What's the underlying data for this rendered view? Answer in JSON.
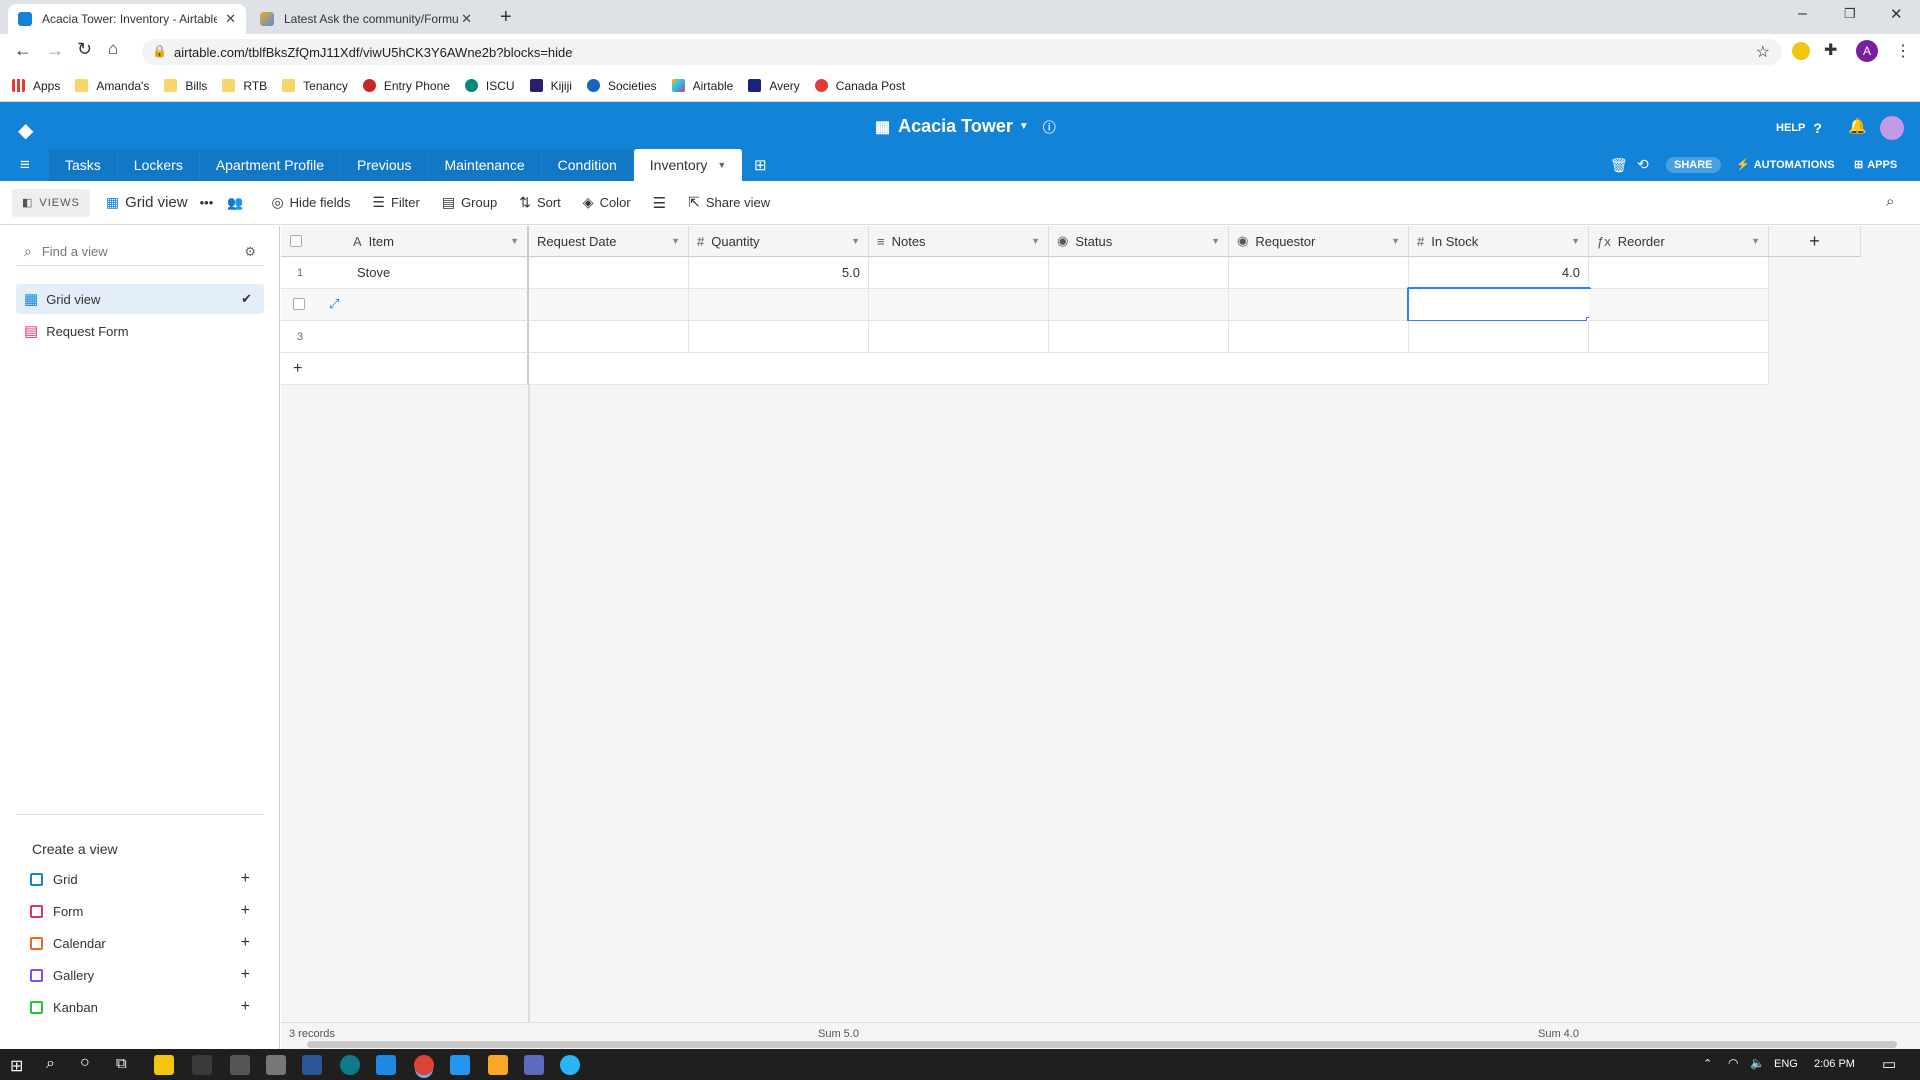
{
  "browser": {
    "tabs": [
      {
        "title": "Acacia Tower: Inventory - Airtable",
        "active": true
      },
      {
        "title": "Latest Ask the community/Formu",
        "active": false
      }
    ],
    "url": "airtable.com/tblfBksZfQmJ11Xdf/viwU5hCK3Y6AWne2b?blocks=hide",
    "profile_initial": "A",
    "bookmarks": [
      "Apps",
      "Amanda's",
      "Bills",
      "RTB",
      "Tenancy",
      "Entry Phone",
      "ISCU",
      "Kijiji",
      "Societies",
      "Airtable",
      "Avery",
      "Canada Post"
    ]
  },
  "base": {
    "title": "Acacia Tower",
    "help": "HELP",
    "share": "SHARE",
    "automations": "AUTOMATIONS",
    "apps": "APPS",
    "tables": [
      "Tasks",
      "Lockers",
      "Apartment Profile",
      "Previous",
      "Maintenance",
      "Condition",
      "Inventory"
    ],
    "active_table": "Inventory"
  },
  "viewbar": {
    "views": "VIEWS",
    "current_view": "Grid view",
    "hide_fields": "Hide fields",
    "filter": "Filter",
    "group": "Group",
    "sort": "Sort",
    "color": "Color",
    "share_view": "Share view"
  },
  "sidebar": {
    "find_placeholder": "Find a view",
    "views": [
      "Grid view",
      "Request Form"
    ],
    "create_label": "Create a view",
    "create_types": [
      "Grid",
      "Form",
      "Calendar",
      "Gallery",
      "Kanban"
    ]
  },
  "grid": {
    "columns": [
      "Item",
      "Request Date",
      "Quantity",
      "Notes",
      "Status",
      "Requestor",
      "In Stock",
      "Reorder"
    ],
    "rows": [
      {
        "num": "1",
        "item": "Stove",
        "quantity": "5.0",
        "in_stock": "4.0"
      },
      {
        "num": "",
        "item": "",
        "quantity": "",
        "in_stock": ""
      },
      {
        "num": "3",
        "item": "",
        "quantity": "",
        "in_stock": ""
      }
    ],
    "add_row": "+",
    "add_field": "+",
    "records": "3 records",
    "sum_quantity": "Sum 5.0",
    "sum_in_stock": "Sum 4.0"
  },
  "taskbar": {
    "lang": "ENG",
    "time": "2:06 PM"
  },
  "colors": {
    "brand_blue": "#1383d7",
    "selection": "#2d7ff9"
  }
}
